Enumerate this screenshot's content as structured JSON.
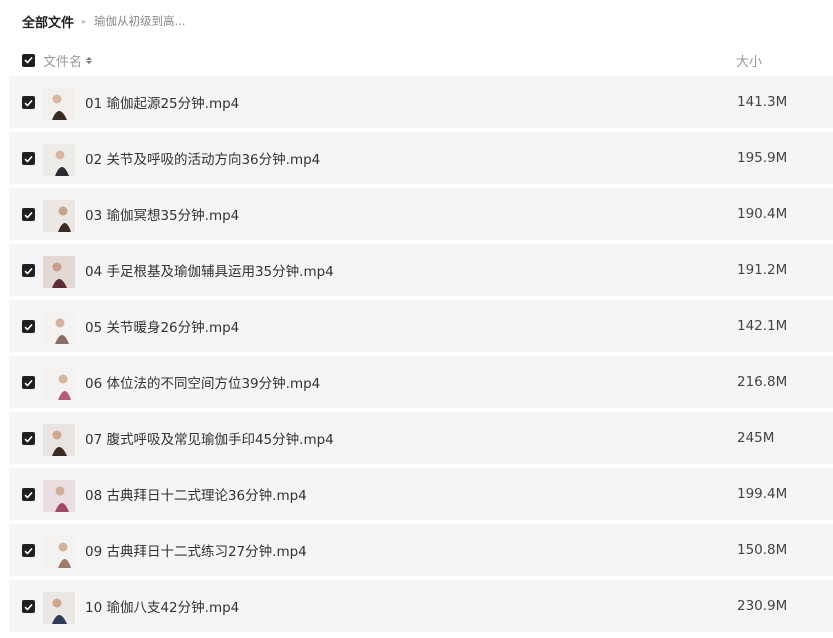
{
  "breadcrumb": {
    "root": "全部文件",
    "separator": "▸",
    "current": "瑜伽从初级到高..."
  },
  "header": {
    "name_label": "文件名",
    "size_label": "大小",
    "select_all_checked": true,
    "sort_icon": "sort-icon"
  },
  "files": [
    {
      "name": "01 瑜伽起源25分钟.mp4",
      "size": "141.3M",
      "checked": true
    },
    {
      "name": "02 关节及呼吸的活动方向36分钟.mp4",
      "size": "195.9M",
      "checked": true
    },
    {
      "name": "03 瑜伽冥想35分钟.mp4",
      "size": "190.4M",
      "checked": true
    },
    {
      "name": "04 手足根基及瑜伽辅具运用35分钟.mp4",
      "size": "191.2M",
      "checked": true
    },
    {
      "name": "05 关节暖身26分钟.mp4",
      "size": "142.1M",
      "checked": true
    },
    {
      "name": "06 体位法的不同空间方位39分钟.mp4",
      "size": "216.8M",
      "checked": true
    },
    {
      "name": "07 腹式呼吸及常见瑜伽手印45分钟.mp4",
      "size": "245M",
      "checked": true
    },
    {
      "name": "08 古典拜日十二式理论36分钟.mp4",
      "size": "199.4M",
      "checked": true
    },
    {
      "name": "09 古典拜日十二式练习27分钟.mp4",
      "size": "150.8M",
      "checked": true
    },
    {
      "name": "10 瑜伽八支42分钟.mp4",
      "size": "230.9M",
      "checked": true
    }
  ],
  "colors": {
    "row_background": "#f5f5f6",
    "checkbox_fill": "#1f1f1f",
    "text": "#333333",
    "muted_text": "#999999"
  }
}
